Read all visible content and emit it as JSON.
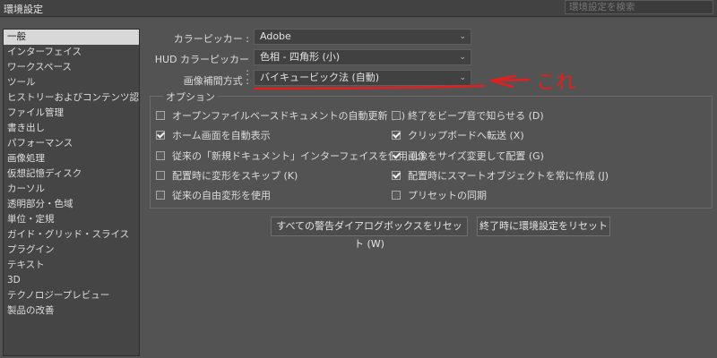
{
  "window": {
    "title": "環境設定",
    "search_placeholder": "環境設定を検索"
  },
  "sidebar": {
    "items": [
      {
        "label": "一般",
        "selected": true
      },
      {
        "label": "インターフェイス"
      },
      {
        "label": "ワークスペース"
      },
      {
        "label": "ツール"
      },
      {
        "label": "ヒストリーおよびコンテンツ認証情報"
      },
      {
        "label": "ファイル管理"
      },
      {
        "label": "書き出し"
      },
      {
        "label": "パフォーマンス"
      },
      {
        "label": "画像処理"
      },
      {
        "label": "仮想記憶ディスク"
      },
      {
        "label": "カーソル"
      },
      {
        "label": "透明部分・色域"
      },
      {
        "label": "単位・定規"
      },
      {
        "label": "ガイド・グリッド・スライス"
      },
      {
        "label": "プラグイン"
      },
      {
        "label": "テキスト"
      },
      {
        "label": "3D"
      },
      {
        "label": "テクノロジープレビュー"
      },
      {
        "label": "製品の改善"
      }
    ]
  },
  "general": {
    "color_picker_label": "カラーピッカー :",
    "color_picker_value": "Adobe",
    "hud_color_picker_label": "HUD カラーピッカー :",
    "hud_color_picker_value": "色相 - 四角形 (小)",
    "interpolation_label": "画像補間方式 :",
    "interpolation_value": "バイキュービック法 (自動)"
  },
  "options": {
    "legend": "オプション",
    "left": [
      {
        "label": "オープンファイルベースドキュメントの自動更新 (A)",
        "checked": false
      },
      {
        "label": "ホーム画面を自動表示",
        "checked": true
      },
      {
        "label": "従来の「新規ドキュメント」インターフェイスを使用 (L)",
        "checked": false
      },
      {
        "label": "配置時に変形をスキップ (K)",
        "checked": false
      },
      {
        "label": "従来の自由変形を使用",
        "checked": false
      }
    ],
    "right": [
      {
        "label": "終了をビープ音で知らせる (D)",
        "checked": false
      },
      {
        "label": "クリップボードへ転送 (X)",
        "checked": true
      },
      {
        "label": "画像をサイズ変更して配置 (G)",
        "checked": true
      },
      {
        "label": "配置時にスマートオブジェクトを常に作成 (J)",
        "checked": true
      },
      {
        "label": "プリセットの同期",
        "checked": false
      }
    ]
  },
  "buttons": {
    "reset_warnings": "すべての警告ダイアログボックスをリセット (W)",
    "reset_on_quit": "終了時に環境設定をリセット"
  },
  "annotation": {
    "text": "これ",
    "color": "#e02020"
  }
}
